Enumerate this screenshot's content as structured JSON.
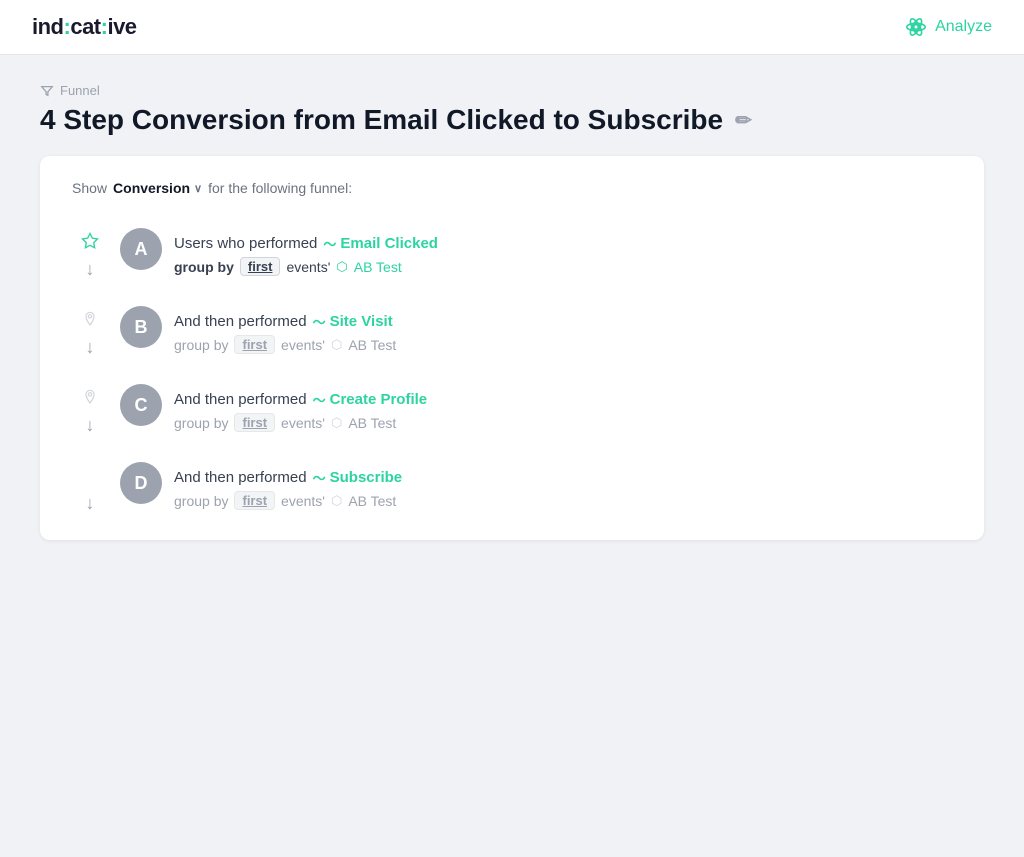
{
  "header": {
    "logo": "ind:cat:ive",
    "logo_parts": {
      "ind": "ind",
      "colon1": ":",
      "cat": "cat",
      "colon2": ":",
      "ive": "ive"
    },
    "analyze_label": "Analyze"
  },
  "breadcrumb": {
    "label": "Funnel"
  },
  "page_title": "4 Step Conversion from Email Clicked to Subscribe",
  "show_bar": {
    "prefix": "Show",
    "metric": "Conversion",
    "suffix": "for the following funnel:"
  },
  "steps": [
    {
      "id": "A",
      "prefix": "Users who performed",
      "event": "Email Clicked",
      "group_by": "group by",
      "first": "first",
      "events_suffix": "events'",
      "tag_label": "AB Test",
      "is_active": true,
      "show_side_icon": "star"
    },
    {
      "id": "B",
      "prefix": "And then performed",
      "event": "Site Visit",
      "group_by": "group by",
      "first": "first",
      "events_suffix": "events'",
      "tag_label": "AB Test",
      "is_active": false,
      "show_side_icon": "pin"
    },
    {
      "id": "C",
      "prefix": "And then performed",
      "event": "Create Profile",
      "group_by": "group by",
      "first": "first",
      "events_suffix": "events'",
      "tag_label": "AB Test",
      "is_active": false,
      "show_side_icon": "pin"
    },
    {
      "id": "D",
      "prefix": "And then performed",
      "event": "Subscribe",
      "group_by": "group by",
      "first": "first",
      "events_suffix": "events'",
      "tag_label": "AB Test",
      "is_active": false,
      "show_side_icon": "none"
    }
  ],
  "colors": {
    "teal": "#2dd4a0",
    "gray_circle": "#9ca3af",
    "faded_text": "#9ca3af"
  }
}
